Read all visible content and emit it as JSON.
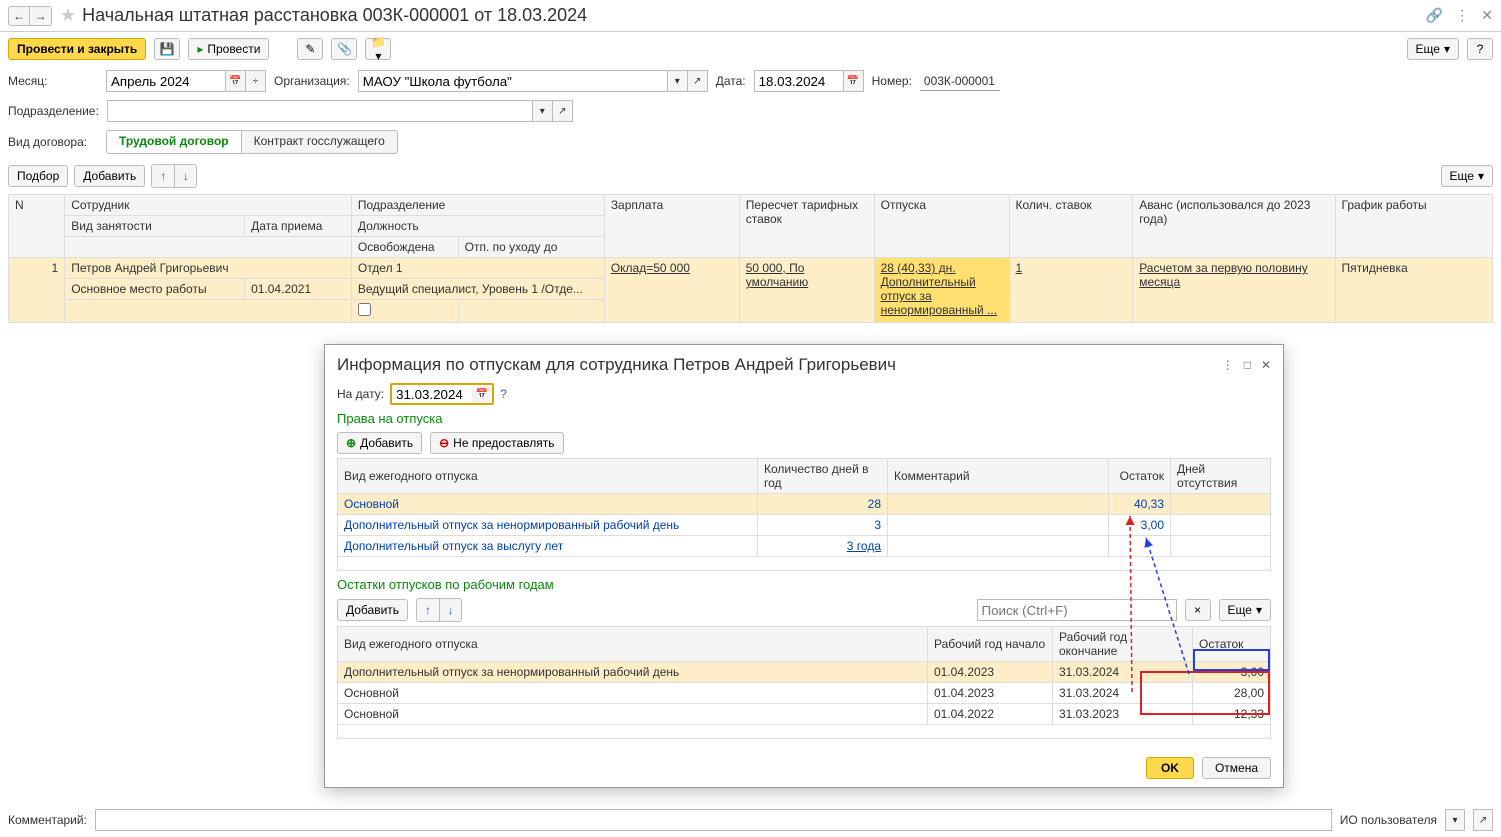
{
  "title": "Начальная штатная расстановка 003К-000001 от 18.03.2024",
  "toolbar": {
    "post_close": "Провести и закрыть",
    "post": "Провести",
    "more": "Еще"
  },
  "form": {
    "month_label": "Месяц:",
    "month_value": "Апрель 2024",
    "org_label": "Организация:",
    "org_value": "МАОУ \"Школа футбола\"",
    "date_label": "Дата:",
    "date_value": "18.03.2024",
    "number_label": "Номер:",
    "number_value": "003К-000001",
    "dept_label": "Подразделение:",
    "dept_value": "",
    "contract_label": "Вид договора:",
    "contract_labor": "Трудовой договор",
    "contract_gov": "Контракт госслужащего"
  },
  "grid_toolbar": {
    "pick": "Подбор",
    "add": "Добавить",
    "more": "Еще"
  },
  "grid": {
    "headers": {
      "n": "N",
      "employee": "Сотрудник",
      "emp_type": "Вид занятости",
      "hire_date": "Дата приема",
      "dept": "Подразделение",
      "position": "Должность",
      "released": "Освобождена",
      "maternity": "Отп. по уходу до",
      "salary": "Зарплата",
      "recalc": "Пересчет тарифных ставок",
      "vacations": "Отпуска",
      "rate": "Колич. ставок",
      "advance": "Аванс (использовался до 2023 года)",
      "schedule": "График работы"
    },
    "row": {
      "n": "1",
      "employee": "Петров Андрей Григорьевич",
      "emp_type": "Основное место работы",
      "hire_date": "01.04.2021",
      "dept": "Отдел 1",
      "position": "Ведущий специалист, Уровень 1 /Отде...",
      "salary": "Оклад=50 000",
      "recalc": "50 000, По умолчанию",
      "vacations": "28 (40,33) дн. Дополнительный отпуск за ненормированный ...",
      "rate": "1",
      "advance": "Расчетом за первую половину месяца",
      "schedule": "Пятидневка"
    }
  },
  "popup": {
    "title": "Информация по отпускам для сотрудника Петров Андрей Григорьевич",
    "date_label": "На дату:",
    "date_value": "31.03.2024",
    "rights_heading": "Права на отпуска",
    "add": "Добавить",
    "deny": "Не предоставлять",
    "rights_headers": {
      "type": "Вид ежегодного отпуска",
      "days": "Количество дней в год",
      "comment": "Комментарий",
      "balance": "Остаток",
      "absence": "Дней отсутствия"
    },
    "rights_rows": [
      {
        "type": "Основной",
        "days": "28",
        "comment": "",
        "balance": "40,33",
        "absence": ""
      },
      {
        "type": "Дополнительный отпуск за ненормированный рабочий день",
        "days": "3",
        "comment": "",
        "balance": "3,00",
        "absence": ""
      },
      {
        "type": "Дополнительный отпуск за выслугу лет",
        "days": "3 года",
        "comment": "",
        "balance": "",
        "absence": ""
      }
    ],
    "balances_heading": "Остатки отпусков по рабочим годам",
    "search_placeholder": "Поиск (Ctrl+F)",
    "balances_headers": {
      "type": "Вид ежегодного отпуска",
      "start": "Рабочий год начало",
      "end": "Рабочий год окончание",
      "balance": "Остаток"
    },
    "balances_rows": [
      {
        "type": "Дополнительный отпуск за ненормированный рабочий день",
        "start": "01.04.2023",
        "end": "31.03.2024",
        "balance": "3,00"
      },
      {
        "type": "Основной",
        "start": "01.04.2023",
        "end": "31.03.2024",
        "balance": "28,00"
      },
      {
        "type": "Основной",
        "start": "01.04.2022",
        "end": "31.03.2023",
        "balance": "12,33"
      }
    ],
    "ok": "OK",
    "cancel": "Отмена"
  },
  "bottom": {
    "comment_label": "Комментарий:",
    "user_label": "ИО пользователя"
  },
  "help": "?"
}
